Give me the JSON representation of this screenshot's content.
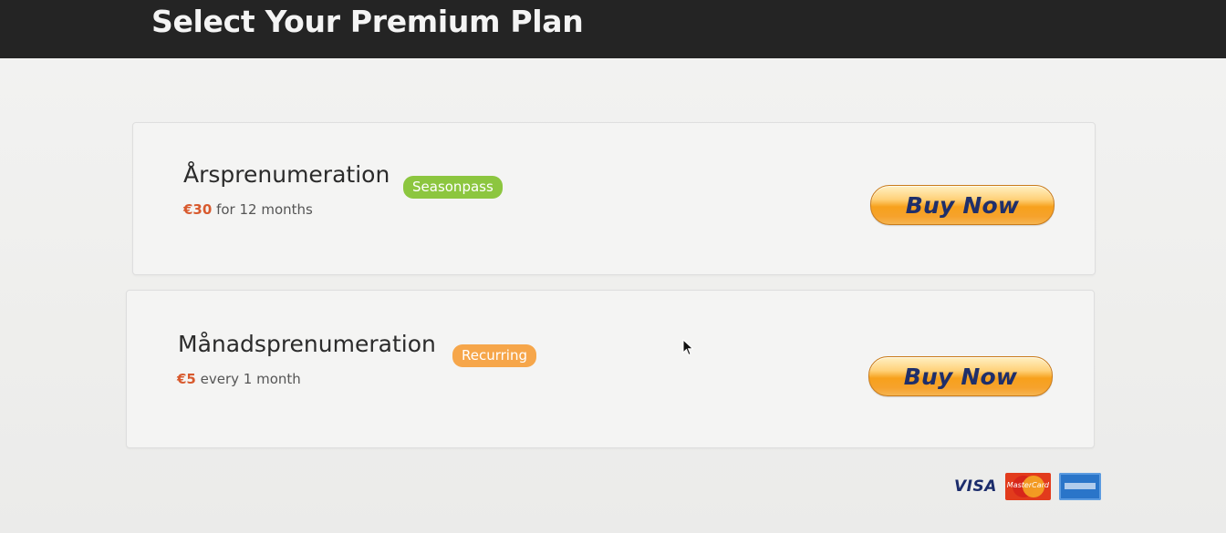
{
  "header": {
    "title": "Select Your Premium Plan"
  },
  "plans": [
    {
      "name": "Årsprenumeration",
      "badge": "Seasonpass",
      "badge_color": "#8cc63f",
      "price": "€30",
      "period": "for 12 months",
      "button_label": "Buy Now"
    },
    {
      "name": "Månadsprenumeration",
      "badge": "Recurring",
      "badge_color": "#f6a64a",
      "price": "€5",
      "period": "every 1 month",
      "button_label": "Buy Now"
    }
  ],
  "payment_methods": {
    "visa_label": "VISA",
    "mastercard_label": "MasterCard",
    "icons": [
      "visa-icon",
      "mastercard-icon",
      "amex-icon"
    ]
  },
  "colors": {
    "price": "#d85a2e",
    "header_bg": "#242424",
    "button_text": "#1f2f6a"
  }
}
